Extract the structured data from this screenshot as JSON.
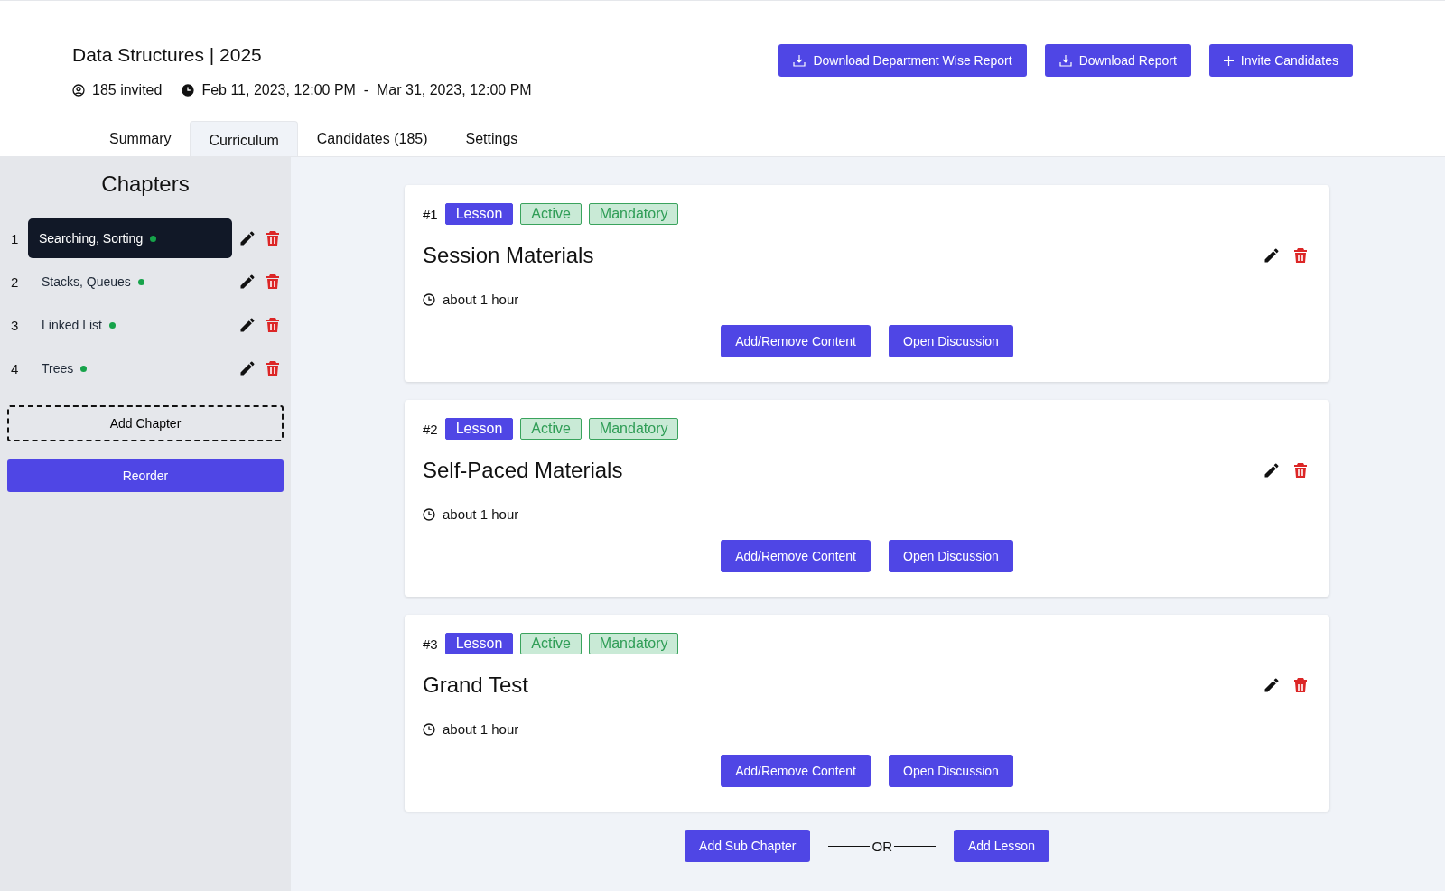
{
  "header": {
    "title": "Data Structures",
    "title_separator": "|",
    "year": "2025",
    "invited": "185 invited",
    "start": "Feb 11, 2023, 12:00 PM",
    "separator": "-",
    "end": "Mar 31, 2023, 12:00 PM",
    "actions": [
      {
        "label": "Download Department Wise Report",
        "kind": "download"
      },
      {
        "label": "Download Report",
        "kind": "download"
      },
      {
        "label": "Invite Candidates",
        "kind": "add"
      }
    ]
  },
  "tabs": [
    {
      "label": "Summary",
      "selected": false
    },
    {
      "label": "Curriculum",
      "selected": true
    },
    {
      "label": "Candidates (185)",
      "selected": false
    },
    {
      "label": "Settings",
      "selected": false
    }
  ],
  "sidebar": {
    "title": "Chapters",
    "chapters": [
      {
        "number": "1",
        "name": "Searching, Sorting",
        "selected": true,
        "color": "#16a34a"
      },
      {
        "number": "2",
        "name": "Stacks, Queues",
        "selected": false,
        "color": "#16a34a"
      },
      {
        "number": "3",
        "name": "Linked List",
        "selected": false,
        "color": "#16a34a"
      },
      {
        "number": "4",
        "name": "Trees",
        "selected": false,
        "color": "#16a34a"
      }
    ],
    "add_chapter": "Add Chapter",
    "reorder": "Reorder"
  },
  "lessons": [
    {
      "index": "#1",
      "tags": [
        {
          "label": "Lesson",
          "kind": "type"
        },
        {
          "label": "Active",
          "kind": "status"
        },
        {
          "label": "Mandatory",
          "kind": "status"
        }
      ],
      "title": "Session Materials",
      "duration": "about 1 hour",
      "buttons": [
        "Add/Remove Content",
        "Open Discussion"
      ]
    },
    {
      "index": "#2",
      "tags": [
        {
          "label": "Lesson",
          "kind": "type"
        },
        {
          "label": "Active",
          "kind": "status"
        },
        {
          "label": "Mandatory",
          "kind": "status"
        }
      ],
      "title": "Self-Paced Materials",
      "duration": "about 1 hour",
      "buttons": [
        "Add/Remove Content",
        "Open Discussion"
      ]
    },
    {
      "index": "#3",
      "tags": [
        {
          "label": "Lesson",
          "kind": "type"
        },
        {
          "label": "Active",
          "kind": "status"
        },
        {
          "label": "Mandatory",
          "kind": "status"
        }
      ],
      "title": "Grand Test",
      "duration": "about 1 hour",
      "buttons": [
        "Add/Remove Content",
        "Open Discussion"
      ]
    }
  ],
  "footer": {
    "add_sub_chapter": "Add Sub Chapter",
    "or": "OR",
    "add_lesson": "Add Lesson"
  }
}
